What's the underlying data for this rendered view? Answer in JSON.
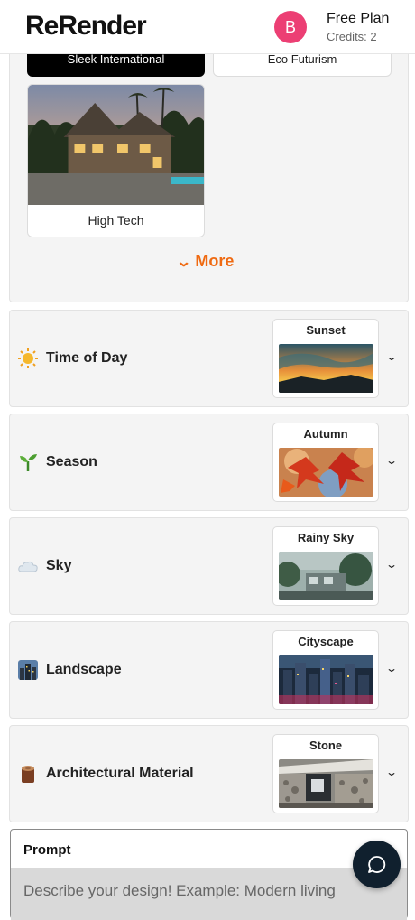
{
  "header": {
    "logo": "ReRender",
    "avatar_letter": "B",
    "plan": "Free Plan",
    "credits": "Credits: 2"
  },
  "styles": {
    "items": [
      {
        "label": "Sleek International",
        "selected": true
      },
      {
        "label": "Eco Futurism",
        "selected": false
      },
      {
        "label": "High Tech",
        "selected": false
      }
    ],
    "more_label": "More"
  },
  "sections": [
    {
      "label": "Time of Day",
      "icon": "sun-icon",
      "selected": "Sunset"
    },
    {
      "label": "Season",
      "icon": "sprout-icon",
      "selected": "Autumn"
    },
    {
      "label": "Sky",
      "icon": "cloud-icon",
      "selected": "Rainy Sky"
    },
    {
      "label": "Landscape",
      "icon": "city-icon",
      "selected": "Cityscape"
    },
    {
      "label": "Architectural Material",
      "icon": "log-icon",
      "selected": "Stone"
    }
  ],
  "prompt": {
    "title": "Prompt",
    "placeholder": "Describe your design! Example: Modern living"
  },
  "colors": {
    "accent": "#ef6a12",
    "avatar": "#ec3f74",
    "chat_button": "#10202e"
  }
}
